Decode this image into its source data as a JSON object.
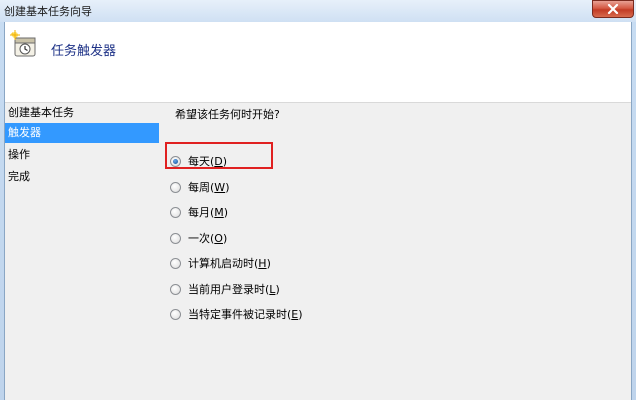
{
  "window": {
    "title": "创建基本任务向导"
  },
  "header": {
    "title": "任务触发器",
    "icon": "task-wizard-icon"
  },
  "nav": {
    "items": [
      {
        "label": "创建基本任务",
        "selected": false
      },
      {
        "label": "触发器",
        "selected": true
      },
      {
        "label": "操作",
        "selected": false
      },
      {
        "label": "完成",
        "selected": false
      }
    ]
  },
  "main": {
    "question": "希望该任务何时开始?",
    "options": [
      {
        "label": "每天",
        "key": "D",
        "checked": true
      },
      {
        "label": "每周",
        "key": "W",
        "checked": false
      },
      {
        "label": "每月",
        "key": "M",
        "checked": false
      },
      {
        "label": "一次",
        "key": "O",
        "checked": false
      },
      {
        "label": "计算机启动时",
        "key": "H",
        "checked": false
      },
      {
        "label": "当前用户登录时",
        "key": "L",
        "checked": false
      },
      {
        "label": "当特定事件被记录时",
        "key": "E",
        "checked": false
      }
    ]
  },
  "colors": {
    "selection": "#3399ff",
    "highlight_box": "#e02020",
    "header_title": "#1e3287"
  }
}
